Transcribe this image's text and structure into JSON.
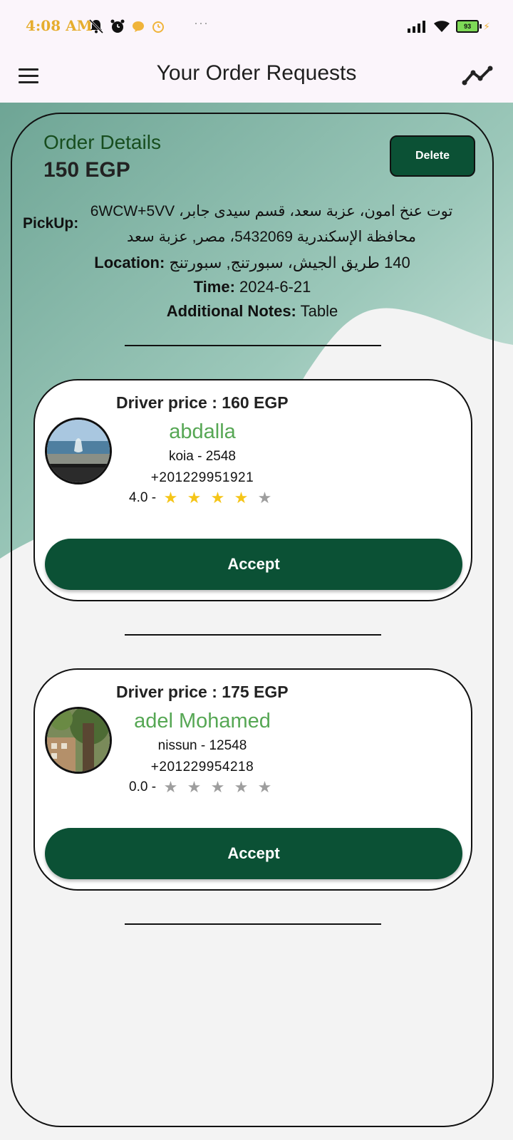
{
  "status_bar": {
    "time": "4:08 AM",
    "more_indicator": "···",
    "battery_level": "93"
  },
  "app_bar": {
    "title": "Your Order Requests",
    "left_icon": "menu-icon",
    "right_icon": "trend-icon"
  },
  "order": {
    "title": "Order Details",
    "price": "150 EGP",
    "delete_label": "Delete",
    "pickup_label": "PickUp:",
    "pickup_line1": "توت عنخ امون، عزبة سعد، قسم سيدى جابر، 6WCW+5VV",
    "pickup_line2": "محافظة الإسكندرية 5432069، مصر, عزبة سعد",
    "location_label": "Location:",
    "location_value": "140 طريق الجيش، سبورتنج, سبورتنج",
    "time_label": "Time:",
    "time_value": "2024-6-21",
    "notes_label": "Additional Notes:",
    "notes_value": "Table"
  },
  "drivers": [
    {
      "price_text": "Driver price : 160 EGP",
      "name": "abdalla",
      "car": "koia - 2548",
      "phone": "+201229951921",
      "rating_text": "4.0 -",
      "rating": 4,
      "accept_label": "Accept"
    },
    {
      "price_text": "Driver price : 175 EGP",
      "name": "adel Mohamed",
      "car": "nissun - 12548",
      "phone": "+201229954218",
      "rating_text": "0.0 -",
      "rating": 0,
      "accept_label": "Accept"
    }
  ],
  "colors": {
    "primary": "#0b5135",
    "name_green": "#56a754",
    "star_filled": "#f5c518",
    "star_empty": "#9e9e9e",
    "status_time": "#e6ad2e"
  }
}
